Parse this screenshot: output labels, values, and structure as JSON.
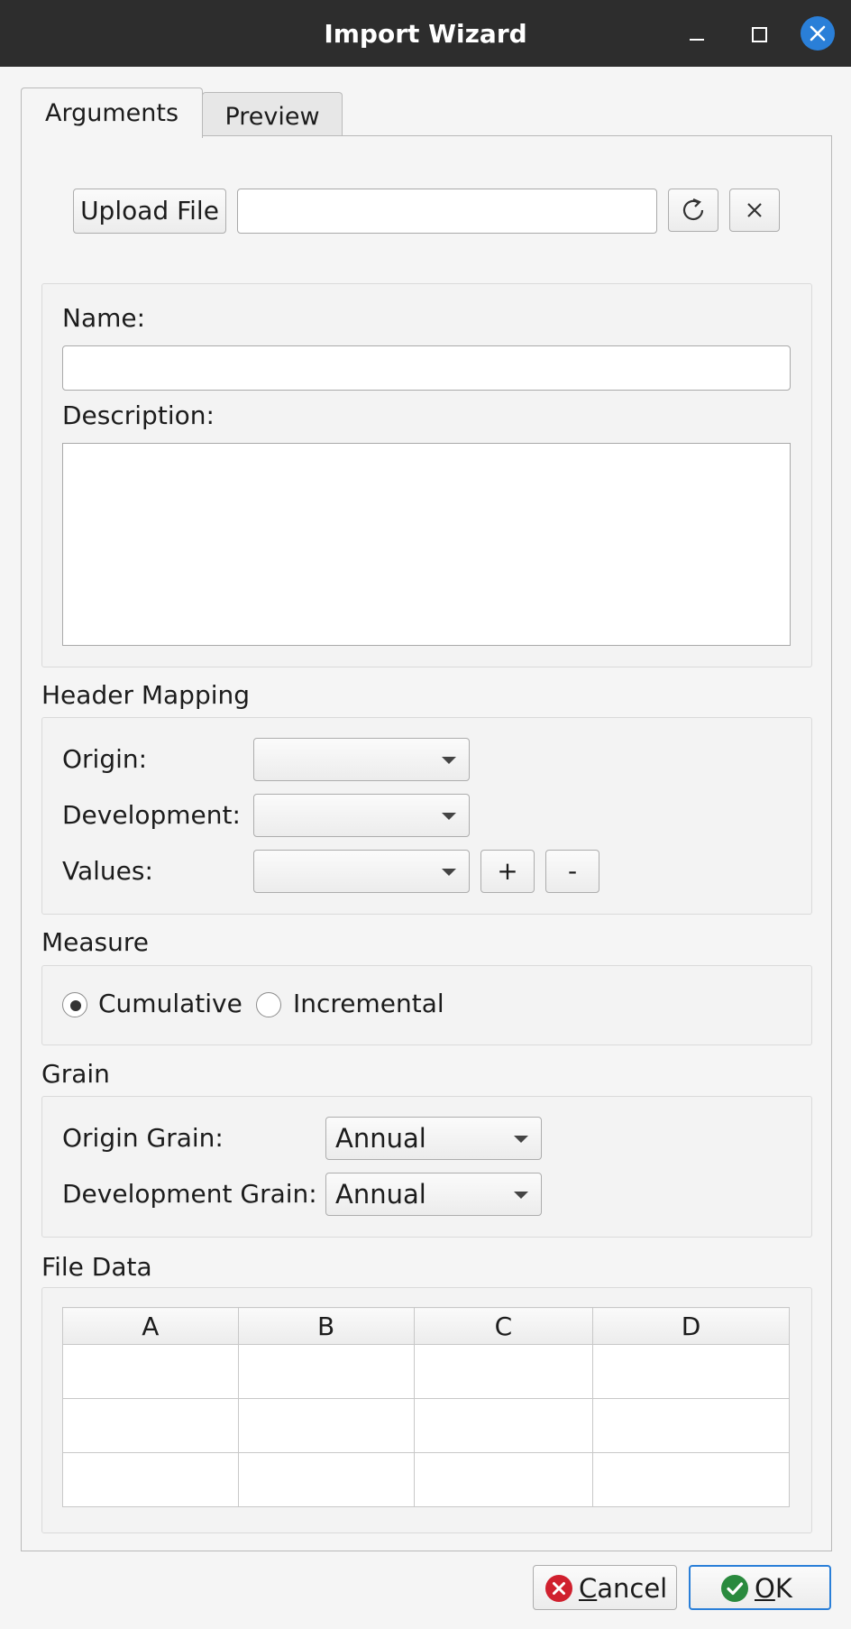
{
  "window": {
    "title": "Import Wizard"
  },
  "tabs": [
    {
      "label": "Arguments",
      "active": true
    },
    {
      "label": "Preview",
      "active": false
    }
  ],
  "file": {
    "upload_label": "Upload File",
    "path_value": "",
    "refresh_icon": "refresh-icon",
    "clear_icon": "close-icon"
  },
  "details": {
    "name_label": "Name:",
    "name_value": "",
    "description_label": "Description:",
    "description_value": ""
  },
  "header_mapping": {
    "title": "Header Mapping",
    "origin_label": "Origin:",
    "origin_value": "",
    "development_label": "Development:",
    "development_value": "",
    "values_label": "Values:",
    "values_value": "",
    "add_label": "+",
    "remove_label": "-"
  },
  "measure": {
    "title": "Measure",
    "options": [
      "Cumulative",
      "Incremental"
    ],
    "selected": "Cumulative"
  },
  "grain": {
    "title": "Grain",
    "origin_label": "Origin Grain:",
    "origin_value": "Annual",
    "development_label": "Development Grain:",
    "development_value": "Annual"
  },
  "file_data": {
    "title": "File Data",
    "columns": [
      "A",
      "B",
      "C",
      "D"
    ],
    "row_count": 3
  },
  "footer": {
    "cancel_label": "Cancel",
    "ok_label": "OK"
  },
  "colors": {
    "accent": "#2a7fd8",
    "cancel_icon": "#d0202e",
    "ok_icon": "#2a8a3e"
  }
}
